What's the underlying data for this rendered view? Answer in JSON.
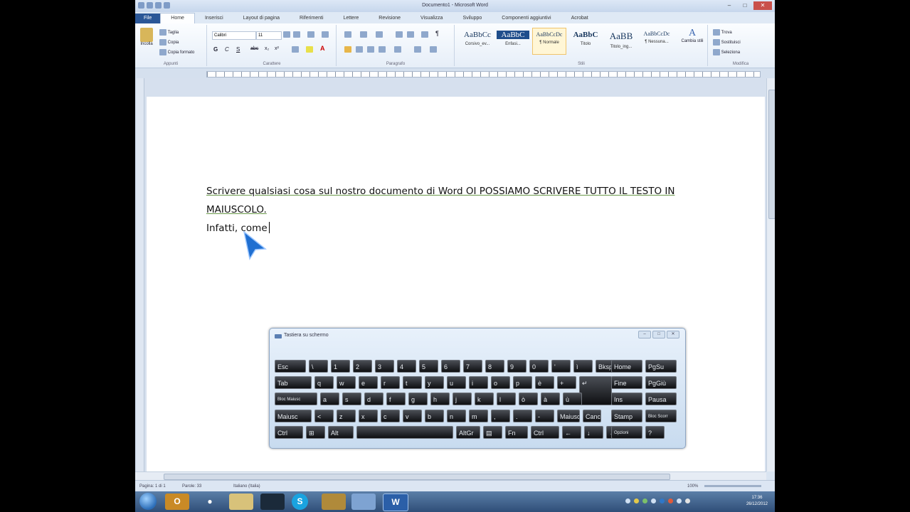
{
  "window": {
    "title": "Documento1 - Microsoft Word",
    "controls": {
      "min": "–",
      "max": "□",
      "close": "✕"
    }
  },
  "tabs": [
    "File",
    "Home",
    "Inserisci",
    "Layout di pagina",
    "Riferimenti",
    "Lettere",
    "Revisione",
    "Visualizza",
    "Sviluppo",
    "Componenti aggiuntivi",
    "Acrobat"
  ],
  "ribbon": {
    "clipboard": {
      "paste": "Incolla",
      "cut": "Taglia",
      "copy": "Copia",
      "format_painter": "Copia formato",
      "label": "Appunti"
    },
    "font": {
      "name": "Calibri",
      "size": "11",
      "label": "Carattere"
    },
    "paragraph": {
      "label": "Paragrafo"
    },
    "styles": {
      "items": [
        {
          "sample": "AaBbCc",
          "name": "Corsivo_ev..."
        },
        {
          "sample": "AaBbC",
          "name": "Enfasi..."
        },
        {
          "sample": "AaBbCcDc",
          "name": "¶ Normale"
        },
        {
          "sample": "AaBbC",
          "name": "Titolo"
        },
        {
          "sample": "AaBB",
          "name": "Titolo_ing..."
        },
        {
          "sample": "AaBbCcDc",
          "name": "¶ Nessuna..."
        }
      ],
      "change_styles": "Cambia stili",
      "label": "Stili"
    },
    "editing": {
      "find": "Trova",
      "replace": "Sostituisci",
      "select": "Seleziona",
      "label": "Modifica"
    }
  },
  "document": {
    "line1": "Scrivere qualsiasi cosa sul nostro documento di Word OI POSSIAMO SCRIVERE TUTTO IL TESTO IN",
    "line2": "MAIUSCOLO.",
    "line3": "Infatti, come"
  },
  "status": {
    "page": "Pagina: 1 di 1",
    "words": "Parole: 33",
    "language": "Italiano (Italia)",
    "zoom": "100%"
  },
  "osk": {
    "title": "Tastiera su schermo",
    "buttons": {
      "min": "–",
      "max": "□",
      "close": "✕"
    },
    "rows": [
      [
        "Esc",
        "\\",
        "1",
        "2",
        "3",
        "4",
        "5",
        "6",
        "7",
        "8",
        "9",
        "0",
        "'",
        "ì",
        "Bksp",
        "Home",
        "PgSu"
      ],
      [
        "Tab",
        "q",
        "w",
        "e",
        "r",
        "t",
        "y",
        "u",
        "i",
        "o",
        "p",
        "è",
        "+",
        "↵",
        "Fine",
        "PgGiù"
      ],
      [
        "Bloc Maiusc",
        "a",
        "s",
        "d",
        "f",
        "g",
        "h",
        "j",
        "k",
        "l",
        "ò",
        "à",
        "ù",
        "Ins",
        "Pausa"
      ],
      [
        "Maiusc",
        "<",
        "z",
        "x",
        "c",
        "v",
        "b",
        "n",
        "m",
        ",",
        ".",
        "-",
        "Maiusc",
        "Canc",
        "Stamp",
        "Bloc Scorr"
      ],
      [
        "Ctrl",
        "⊞",
        "Alt",
        "",
        "AltGr",
        "▤",
        "Fn",
        "Ctrl",
        "←",
        "↓",
        "→",
        "Opzioni",
        "?"
      ]
    ]
  },
  "taskbar": {
    "clock_time": "17:36",
    "clock_date": "26/12/2012"
  }
}
